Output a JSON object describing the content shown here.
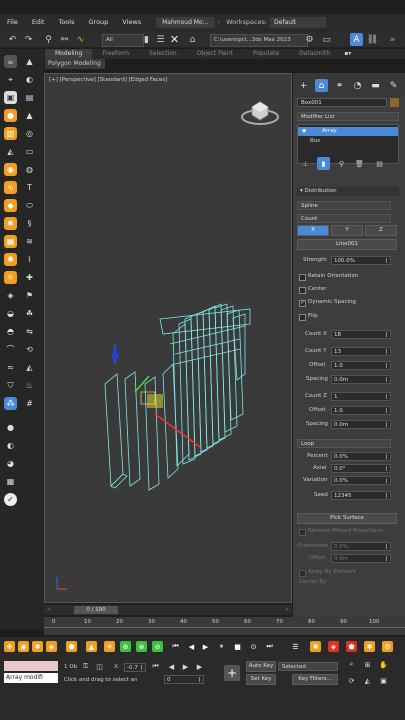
{
  "menubar": {
    "items": [
      "File",
      "Edit",
      "Tools",
      "Group",
      "Views"
    ],
    "user": "Mahmoud Mo…",
    "workspaces_label": "Workspaces:",
    "workspace_value": "Default"
  },
  "toolbar": {
    "filter_value": "All",
    "path_value": "C:\\users\\pc\\...3ds Max 2023",
    "view_dropdown": "Vi…"
  },
  "ribbon": {
    "tabs": [
      "Modeling",
      "Freeform",
      "Selection",
      "Object Paint",
      "Populate",
      "Datasmith"
    ],
    "active_tab": "Modeling",
    "sub_label": "Polygon Modeling"
  },
  "viewport": {
    "label": "[+] [Perspective] [Standard] [Edged Faces]"
  },
  "cmd": {
    "object_name": "Box001",
    "modifier_list": "Modifier List",
    "stack": [
      "Array",
      "Box"
    ],
    "distribution_title": "Distribution",
    "dist_type": "Spline",
    "dist_mode": "Count",
    "axes": [
      "X",
      "Y",
      "Z"
    ],
    "spline_name": "Line001",
    "strength_label": "Strength",
    "strength_value": "100.0%",
    "retain_label": "Retain Orientation",
    "center_label": "Center",
    "dynamic_label": "Dynamic Spacing",
    "flip_label": "Flip",
    "count_x_label": "Count X",
    "count_x_value": "18",
    "count_y_label": "Count Y",
    "count_y_value": "13",
    "offset1_label": "Offset",
    "offset1_value": "1.0",
    "spacing1_label": "Spacing",
    "spacing1_value": "0.0m",
    "count_z_label": "Count Z",
    "count_z_value": "1",
    "offset2_label": "Offset",
    "offset2_value": "1.0",
    "spacing2_label": "Spacing",
    "spacing2_value": "0.0m",
    "loop_label": "Loop",
    "percent_label": "Percent",
    "percent_value": "0.0%",
    "axial_label": "Axial",
    "axial_value": "0.0°",
    "variation_label": "Variation",
    "variation_value": "0.0%",
    "seed_label": "Seed",
    "seed_value": "12345",
    "pick_surface": "Pick Surface",
    "remove_missed": "Remove Missed Projections",
    "orientation_label": "Orientation",
    "orientation_value": "0.0%",
    "offset3_label": "Offset",
    "offset3_value": "0.0m",
    "array_by_element": "Array By Element",
    "center_by": "Center By"
  },
  "timeline": {
    "frame": "0 / 100",
    "ticks": [
      "0",
      "10",
      "20",
      "30",
      "40",
      "50",
      "60",
      "70",
      "80",
      "90",
      "100"
    ]
  },
  "status": {
    "script_text": "Array modifi",
    "selected_count": "1 Ob",
    "prompt": "Click and drag to select an",
    "x_label": "X:",
    "x_value": "-0.7",
    "auto_key": "Auto Key",
    "selected": "Selected",
    "set_key": "Set Key",
    "key_filters": "Key Filters...",
    "frame_value": "0"
  },
  "colors": {
    "accent_blue": "#4a8ad8",
    "wire_cyan": "#7fe8e8",
    "orange_icon": "#f0a020"
  }
}
